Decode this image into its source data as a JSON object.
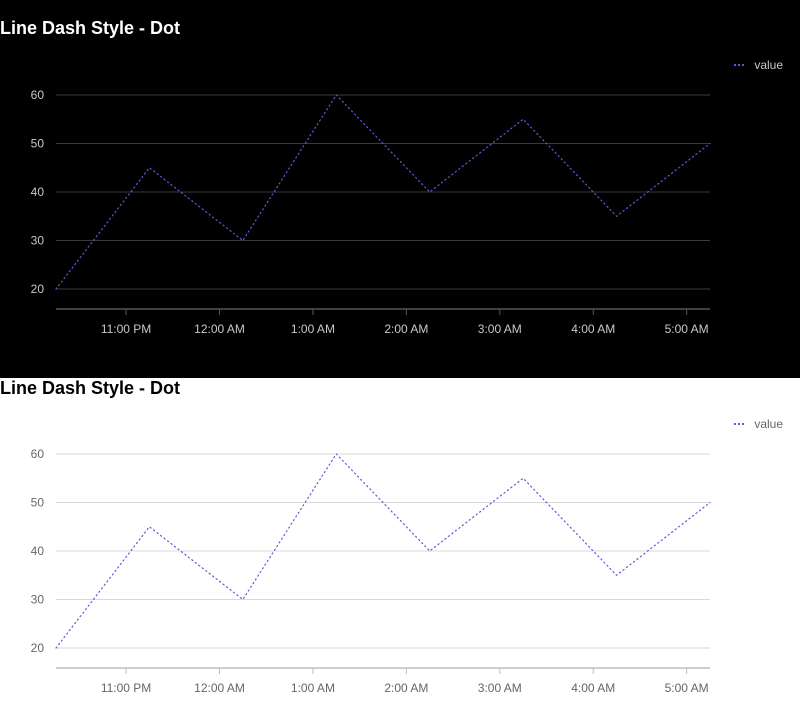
{
  "charts": [
    {
      "theme": "dark",
      "background": "#000000",
      "gridColor": "#3a3a3a",
      "axisColor": "#555555",
      "textColor": "#c8c8c8",
      "titleColor": "#ffffff"
    },
    {
      "theme": "light",
      "background": "#ffffff",
      "gridColor": "#d9d9d9",
      "axisColor": "#bdbdbd",
      "textColor": "#666666",
      "titleColor": "#000000"
    }
  ],
  "chart_data": [
    {
      "type": "line",
      "title": "Line Dash Style - Dot",
      "line_style": "dot",
      "series": [
        {
          "name": "value",
          "color": "#5b5bd6",
          "x": [
            "10:15 PM",
            "11:15 PM",
            "12:15 AM",
            "1:15 AM",
            "2:15 AM",
            "3:15 AM",
            "4:15 AM",
            "5:15 AM"
          ],
          "values": [
            20,
            45,
            30,
            60,
            40,
            55,
            35,
            50
          ]
        }
      ],
      "x_ticks": [
        "11:00 PM",
        "12:00 AM",
        "1:00 AM",
        "2:00 AM",
        "3:00 AM",
        "4:00 AM",
        "5:00 AM"
      ],
      "y_ticks": [
        20,
        30,
        40,
        50,
        60
      ],
      "ylim": [
        20,
        60
      ],
      "grid": true,
      "legend": "top-right"
    },
    {
      "type": "line",
      "title": "Line Dash Style - Dot",
      "line_style": "dot",
      "series": [
        {
          "name": "value",
          "color": "#5b5bd6",
          "x": [
            "10:15 PM",
            "11:15 PM",
            "12:15 AM",
            "1:15 AM",
            "2:15 AM",
            "3:15 AM",
            "4:15 AM",
            "5:15 AM"
          ],
          "values": [
            20,
            45,
            30,
            60,
            40,
            55,
            35,
            50
          ]
        }
      ],
      "x_ticks": [
        "11:00 PM",
        "12:00 AM",
        "1:00 AM",
        "2:00 AM",
        "3:00 AM",
        "4:00 AM",
        "5:00 AM"
      ],
      "y_ticks": [
        20,
        30,
        40,
        50,
        60
      ],
      "ylim": [
        20,
        60
      ],
      "grid": true,
      "legend": "top-right"
    }
  ]
}
